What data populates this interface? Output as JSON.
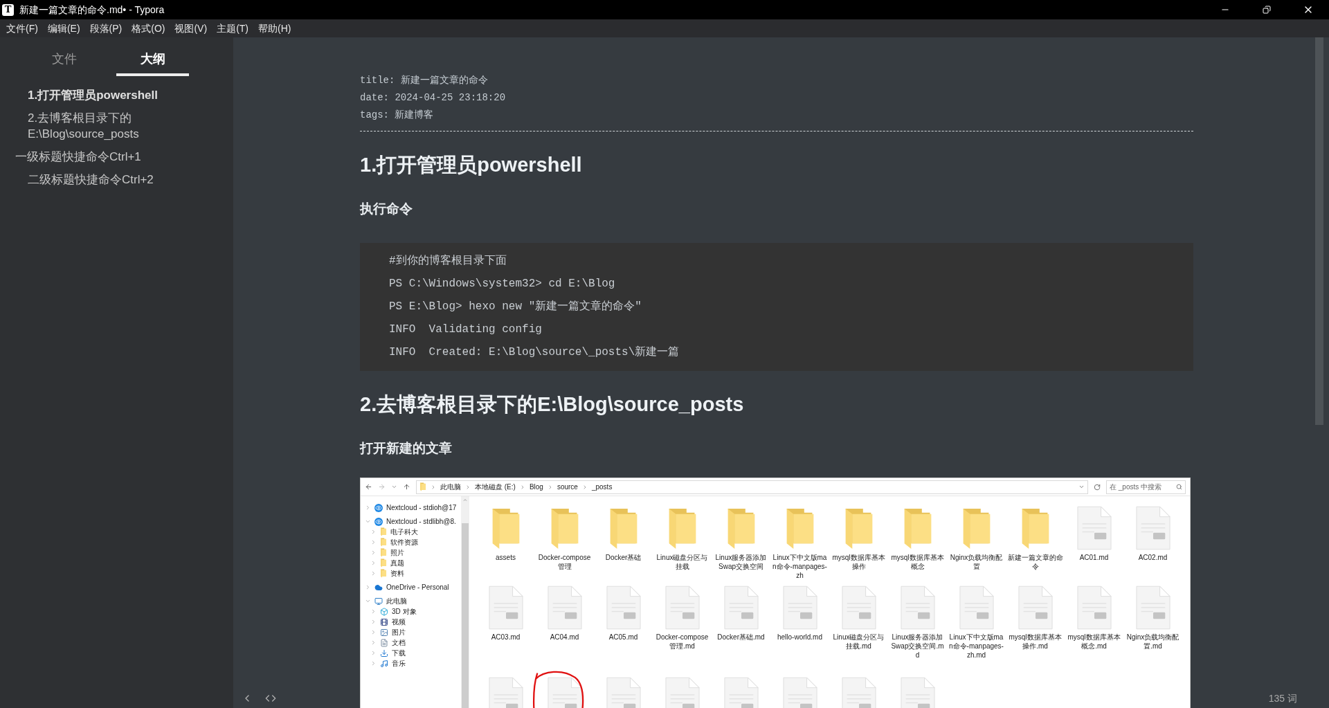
{
  "window": {
    "icon_letter": "T",
    "title": "新建一篇文章的命令.md• - Typora"
  },
  "menu": [
    "文件(F)",
    "编辑(E)",
    "段落(P)",
    "格式(O)",
    "视图(V)",
    "主题(T)",
    "帮助(H)"
  ],
  "sidebar": {
    "tabs": [
      {
        "label": "文件",
        "selected": false
      },
      {
        "label": "大纲",
        "selected": true
      }
    ],
    "outline": [
      {
        "label": "1.打开管理员powershell",
        "kind": "h2",
        "selected": true
      },
      {
        "label": "2.去博客根目录下的E:\\Blog\\source_posts",
        "kind": "h2",
        "selected": false
      },
      {
        "label": "一级标题快捷命令Ctrl+1",
        "kind": "h1",
        "selected": false,
        "children": [
          {
            "label": "二级标题快捷命令Ctrl+2",
            "selected": false
          }
        ]
      }
    ]
  },
  "document": {
    "front_matter": [
      {
        "key": "title:",
        "value": "新建一篇文章的命令"
      },
      {
        "key": "date:",
        "value": "2024-04-25 23:18:20"
      },
      {
        "key": "tags:",
        "value": "新建博客"
      }
    ],
    "heading_1": "1.打开管理员powershell",
    "subheading_1": "执行命令",
    "code_lines": [
      "#到你的博客根目录下面",
      "PS C:\\Windows\\system32> cd E:\\Blog",
      "PS E:\\Blog> hexo new \"新建一篇文章的命令\"",
      "INFO  Validating config",
      "INFO  Created: E:\\Blog\\source\\_posts\\新建一篇"
    ],
    "heading_2": "2.去博客根目录下的E:\\Blog\\source_posts",
    "subheading_2": "打开新建的文章",
    "explorer": {
      "breadcrumbs": [
        "此电脑",
        "本地磁盘 (E:)",
        "Blog",
        "source",
        "_posts"
      ],
      "search_placeholder": "在 _posts 中搜索",
      "nav": [
        {
          "label": "Nextcloud - stdioh@17",
          "kind": "nextcloud",
          "expanded": false
        },
        {
          "label": "Nextcloud - stdlibh@8.",
          "kind": "nextcloud",
          "expanded": true,
          "children": [
            {
              "label": "电子科大",
              "kind": "folder",
              "expanded": false
            },
            {
              "label": "软件资源",
              "kind": "folder",
              "expanded": false
            },
            {
              "label": "照片",
              "kind": "folder",
              "expanded": false
            },
            {
              "label": "真题",
              "kind": "folder",
              "expanded": false
            },
            {
              "label": "资料",
              "kind": "folder",
              "expanded": false
            }
          ]
        },
        {
          "label": "OneDrive - Personal",
          "kind": "onedrive",
          "expanded": false
        },
        {
          "label": "此电脑",
          "kind": "pc",
          "expanded": true,
          "children": [
            {
              "label": "3D 对象",
              "kind": "cube",
              "expanded": false
            },
            {
              "label": "视频",
              "kind": "video",
              "expanded": false
            },
            {
              "label": "图片",
              "kind": "picture",
              "expanded": false
            },
            {
              "label": "文档",
              "kind": "document",
              "expanded": false
            },
            {
              "label": "下载",
              "kind": "download",
              "expanded": false
            },
            {
              "label": "音乐",
              "kind": "music",
              "expanded": false
            }
          ]
        }
      ],
      "files": [
        {
          "name": "assets",
          "kind": "folder"
        },
        {
          "name": "Docker-compose管理",
          "kind": "folder"
        },
        {
          "name": "Docker基础",
          "kind": "folder"
        },
        {
          "name": "Linux磁盘分区与挂载",
          "kind": "folder"
        },
        {
          "name": "Linux服务器添加Swap交换空间",
          "kind": "folder"
        },
        {
          "name": "Linux下中文版man命令-manpages-zh",
          "kind": "folder"
        },
        {
          "name": "mysql数据库基本操作",
          "kind": "folder"
        },
        {
          "name": "mysql数据库基本概念",
          "kind": "folder"
        },
        {
          "name": "Nginx负载均衡配置",
          "kind": "folder"
        },
        {
          "name": "新建一篇文章的命令",
          "kind": "folder"
        },
        {
          "name": "AC01.md",
          "kind": "md"
        },
        {
          "name": "AC02.md",
          "kind": "md"
        },
        {
          "name": "AC03.md",
          "kind": "md"
        },
        {
          "name": "AC04.md",
          "kind": "md"
        },
        {
          "name": "AC05.md",
          "kind": "md"
        },
        {
          "name": "Docker-compose管理.md",
          "kind": "md"
        },
        {
          "name": "Docker基础.md",
          "kind": "md"
        },
        {
          "name": "hello-world.md",
          "kind": "md"
        },
        {
          "name": "Linux磁盘分区与挂载.md",
          "kind": "md"
        },
        {
          "name": "Linux服务器添加Swap交换空间.md",
          "kind": "md"
        },
        {
          "name": "Linux下中文版man命令-manpages-zh.md",
          "kind": "md"
        },
        {
          "name": "mysql数据库基本操作.md",
          "kind": "md"
        },
        {
          "name": "mysql数据库基本概念.md",
          "kind": "md"
        },
        {
          "name": "Nginx负载均衡配置.md",
          "kind": "md"
        },
        {
          "kind": "md"
        },
        {
          "kind": "md",
          "circled": true
        },
        {
          "kind": "md"
        },
        {
          "kind": "md"
        },
        {
          "kind": "md"
        },
        {
          "kind": "md"
        },
        {
          "kind": "md"
        },
        {
          "kind": "md"
        }
      ]
    }
  },
  "status": {
    "word_count": "135 词"
  }
}
